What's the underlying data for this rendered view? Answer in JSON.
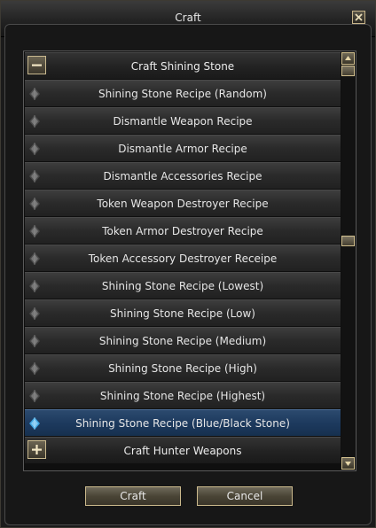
{
  "window": {
    "title": "Craft"
  },
  "list": {
    "items": [
      {
        "label": "Craft Shining Stone",
        "type": "category",
        "toggle": "minus-icon"
      },
      {
        "label": "Shining Stone Recipe (Random)",
        "type": "recipe"
      },
      {
        "label": "Dismantle Weapon Recipe",
        "type": "recipe"
      },
      {
        "label": "Dismantle Armor Recipe",
        "type": "recipe"
      },
      {
        "label": "Dismantle Accessories Recipe",
        "type": "recipe"
      },
      {
        "label": "Token Weapon Destroyer Recipe",
        "type": "recipe"
      },
      {
        "label": "Token Armor Destroyer Recipe",
        "type": "recipe"
      },
      {
        "label": "Token Accessory Destroyer Receipe",
        "type": "recipe"
      },
      {
        "label": "Shining Stone Recipe (Lowest)",
        "type": "recipe"
      },
      {
        "label": "Shining Stone Recipe (Low)",
        "type": "recipe"
      },
      {
        "label": "Shining Stone Recipe (Medium)",
        "type": "recipe"
      },
      {
        "label": "Shining Stone Recipe (High)",
        "type": "recipe"
      },
      {
        "label": "Shining Stone Recipe (Highest)",
        "type": "recipe"
      },
      {
        "label": "Shining Stone Recipe (Blue/Black Stone)",
        "type": "recipe",
        "selected": true
      },
      {
        "label": "Craft Hunter Weapons",
        "type": "category",
        "toggle": "plus-icon"
      }
    ]
  },
  "buttons": {
    "craft_label": "Craft",
    "cancel_label": "Cancel"
  },
  "colors": {
    "selected_row": "#1d3a5e",
    "button_border": "#cbb98c",
    "frame_bg": "#1b1b1b"
  }
}
